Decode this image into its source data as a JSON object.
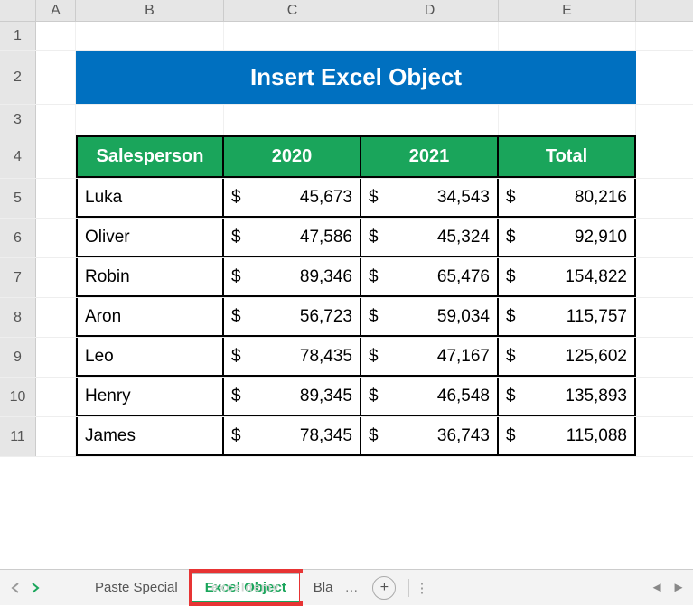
{
  "columns": [
    "A",
    "B",
    "C",
    "D",
    "E"
  ],
  "row_numbers": [
    "1",
    "2",
    "3",
    "4",
    "5",
    "6",
    "7",
    "8",
    "9",
    "10",
    "11"
  ],
  "title": "Insert Excel Object",
  "table": {
    "headers": [
      "Salesperson",
      "2020",
      "2021",
      "Total"
    ],
    "rows": [
      {
        "name": "Luka",
        "y2020": "45,673",
        "y2021": "34,543",
        "total": "80,216"
      },
      {
        "name": "Oliver",
        "y2020": "47,586",
        "y2021": "45,324",
        "total": "92,910"
      },
      {
        "name": "Robin",
        "y2020": "89,346",
        "y2021": "65,476",
        "total": "154,822"
      },
      {
        "name": "Aron",
        "y2020": "56,723",
        "y2021": "59,034",
        "total": "115,757"
      },
      {
        "name": "Leo",
        "y2020": "78,435",
        "y2021": "47,167",
        "total": "125,602"
      },
      {
        "name": "Henry",
        "y2020": "89,345",
        "y2021": "46,548",
        "total": "135,893"
      },
      {
        "name": "James",
        "y2020": "78,345",
        "y2021": "36,743",
        "total": "115,088"
      }
    ]
  },
  "currency_symbol": "$",
  "watermark": "exceldemy",
  "tabs": {
    "prev": "Paste Special",
    "active": "Excel Object",
    "next": "Bla"
  },
  "chart_data": {
    "type": "table",
    "columns": [
      "Salesperson",
      "2020",
      "2021",
      "Total"
    ],
    "rows": [
      [
        "Luka",
        45673,
        34543,
        80216
      ],
      [
        "Oliver",
        47586,
        45324,
        92910
      ],
      [
        "Robin",
        89346,
        65476,
        154822
      ],
      [
        "Aron",
        56723,
        59034,
        115757
      ],
      [
        "Leo",
        78435,
        47167,
        125602
      ],
      [
        "Henry",
        89345,
        46548,
        135893
      ],
      [
        "James",
        78345,
        36743,
        115088
      ]
    ],
    "title": "Insert Excel Object"
  }
}
